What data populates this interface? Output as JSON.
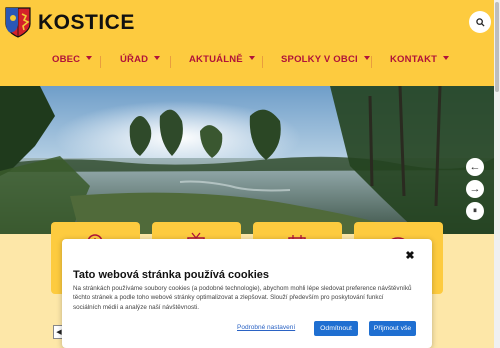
{
  "site": {
    "name": "KOSTICE"
  },
  "nav": {
    "items": [
      {
        "label": "OBEC"
      },
      {
        "label": "ÚŘAD"
      },
      {
        "label": "AKTUÁLNĚ"
      },
      {
        "label": "SPOLKY V OBCI"
      },
      {
        "label": "KONTAKT"
      }
    ]
  },
  "icons": {
    "search": "search-icon",
    "prev": "arrow-left-icon",
    "next": "arrow-right-icon",
    "pause": "pause-icon",
    "close": "close-icon"
  },
  "hero": {
    "prev_glyph": "←",
    "next_glyph": "→",
    "pause_glyph": "⏸"
  },
  "cookie": {
    "title": "Tato webová stránka používá cookies",
    "text": "Na stránkách používáme soubory cookies (a podobné technologie), abychom mohli lépe sledovat preference návštěvníků těchto stránek a podle toho webové stránky optimalizovat a zlepšovat. Slouží především pro poskytování funkcí sociálních médií a analýze naší návštěvnosti.",
    "close_glyph": "✖",
    "settings_label": "Podrobné nastavení",
    "reject_label": "Odmítnout",
    "accept_label": "Přijmout vše"
  },
  "colors": {
    "header_bg": "#fdcb3f",
    "nav_text": "#b0133a",
    "page_bg": "#fde7a8",
    "primary_button": "#1f6fd1"
  }
}
